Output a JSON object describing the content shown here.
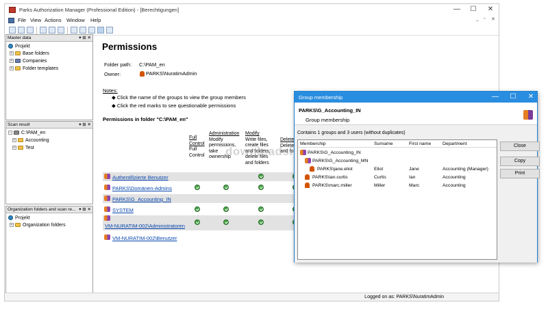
{
  "window": {
    "title": "Parks Authorization Manager (Professional Edition) - [Berechtigungen]",
    "minimize": "—",
    "maximize": "☐",
    "close": "✕"
  },
  "menu": [
    "File",
    "View",
    "Actions",
    "Window",
    "Help"
  ],
  "mdi_controls": {
    "min": "_",
    "restore": "▫",
    "close": "✕"
  },
  "panels": {
    "master": {
      "title": "Master data",
      "controls": "▾ ⊞ ✕",
      "items": [
        "Projekt",
        "Base folders",
        "Companies",
        "Folder templates"
      ]
    },
    "scan": {
      "title": "Scan result",
      "controls": "▾ ⊞ ✕",
      "items": [
        "C:\\PAM_en",
        "Accounting",
        "Test"
      ]
    },
    "org": {
      "title": "Organization folders and scan re...",
      "controls": "▾ ⊞ ✕",
      "items": [
        "Projekt",
        "Organization folders"
      ]
    }
  },
  "main": {
    "heading": "Permissions",
    "folder_path_label": "Folder path:",
    "folder_path_value": "C:\\PAM_en",
    "owner_label": "Owner:",
    "owner_value": "PARKS\\NuratimAdmin",
    "notes_label": "Notes:",
    "note1": "Click the name of the groups to view the group members",
    "note2": "Click the red marks to see questionable permissions",
    "permissions_in_folder": "Permissions in folder \"C:\\PAM_en\"",
    "columns": [
      {
        "title_lines": [
          "Full",
          "Control"
        ],
        "desc_lines": [
          "Full",
          "Control"
        ]
      },
      {
        "title_lines": [
          "Administration"
        ],
        "desc_lines": [
          "Modify",
          "permissions,",
          "take",
          "ownership"
        ]
      },
      {
        "title_lines": [
          "Modify"
        ],
        "desc_lines": [
          "Write files,",
          "create files",
          "and folders,",
          "delete files",
          "and folders"
        ]
      },
      {
        "title_lines": [
          "Delete"
        ],
        "desc_lines": [
          "Delete fi",
          "and folde"
        ]
      }
    ],
    "rows": [
      {
        "name": "Authentifizierte Benutzer",
        "checks": [
          false,
          false,
          true,
          true
        ],
        "shade": true
      },
      {
        "name": "PARKS\\Domänen-Admins",
        "checks": [
          true,
          true,
          true,
          true
        ],
        "shade": false
      },
      {
        "name": "PARKS\\G_Accounting_IN",
        "checks": [
          false,
          false,
          false,
          false
        ],
        "shade": true
      },
      {
        "name": "SYSTEM",
        "checks": [
          true,
          true,
          true,
          true
        ],
        "shade": false
      },
      {
        "name": "VM-NURATIM-002\\Administratoren",
        "checks": [
          true,
          true,
          true,
          true
        ],
        "shade": true
      },
      {
        "name": "VM-NURATIM-002\\Benutzer",
        "checks": [
          false,
          false,
          false,
          false
        ],
        "shade": false
      }
    ]
  },
  "watermark": "downloadsi",
  "status": {
    "logged_on": "Logged on as: PARKS\\NuratimAdmin"
  },
  "dialog": {
    "title": "Group membership",
    "group_name": "PARKS\\G_Accounting_IN",
    "group_type": "Group membership",
    "summary": "Contains 1 groups and 3 users (without duplicates)",
    "headers": [
      "Membership",
      "Surname",
      "First name",
      "Department"
    ],
    "rows": [
      {
        "membership": "PARKS\\G_Accounting_IN",
        "surname": "",
        "first": "",
        "dept": "",
        "level": 0,
        "kind": "group"
      },
      {
        "membership": "PARKS\\G_Accounting_MN",
        "surname": "",
        "first": "",
        "dept": "",
        "level": 1,
        "kind": "group"
      },
      {
        "membership": "PARKS\\jane.eliot",
        "surname": "Eliot",
        "first": "Jane",
        "dept": "Accounting (Manager)",
        "level": 2,
        "kind": "user"
      },
      {
        "membership": "PARKS\\ian.curtis",
        "surname": "Curtis",
        "first": "Ian",
        "dept": "Accounting",
        "level": 1,
        "kind": "user"
      },
      {
        "membership": "PARKS\\marc.miller",
        "surname": "Miller",
        "first": "Marc",
        "dept": "Accounting",
        "level": 1,
        "kind": "user"
      }
    ],
    "buttons": {
      "close": "Close",
      "copy": "Copy",
      "print": "Print"
    },
    "win_min": "—",
    "win_max": "☐",
    "win_close": "✕"
  }
}
